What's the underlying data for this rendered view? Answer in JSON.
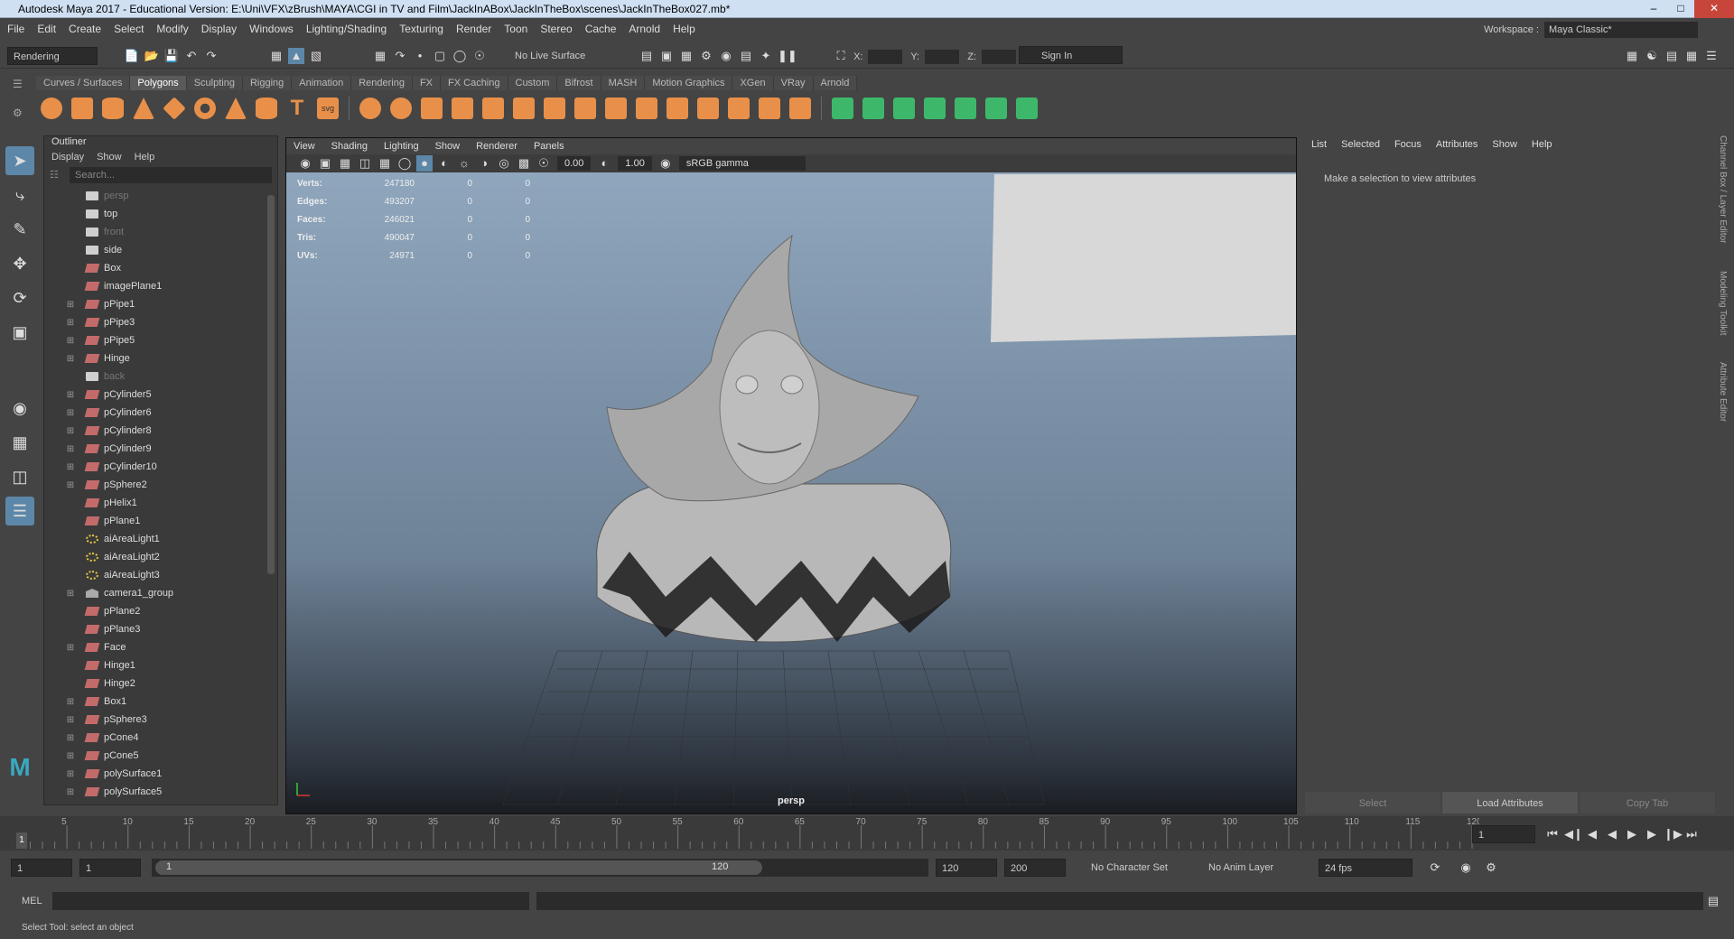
{
  "window": {
    "title": "Autodesk Maya 2017 - Educational Version: E:\\Uni\\VFX\\zBrush\\MAYA\\CGI in TV and Film\\JackInABox\\JackInTheBox\\scenes\\JackInTheBox027.mb*"
  },
  "menu": [
    "File",
    "Edit",
    "Create",
    "Select",
    "Modify",
    "Display",
    "Windows",
    "Lighting/Shading",
    "Texturing",
    "Render",
    "Toon",
    "Stereo",
    "Cache",
    "Arnold",
    "Help"
  ],
  "workspace": {
    "label": "Workspace :",
    "value": "Maya Classic*"
  },
  "status": {
    "menuset": "Rendering",
    "live_surface": "No Live Surface",
    "x_label": "X:",
    "y_label": "Y:",
    "z_label": "Z:",
    "sign_in": "Sign In"
  },
  "shelf_tabs": [
    "Curves / Surfaces",
    "Polygons",
    "Sculpting",
    "Rigging",
    "Animation",
    "Rendering",
    "FX",
    "FX Caching",
    "Custom",
    "Bifrost",
    "MASH",
    "Motion Graphics",
    "XGen",
    "VRay",
    "Arnold"
  ],
  "shelf_active": "Polygons",
  "outliner": {
    "title": "Outliner",
    "menus": [
      "Display",
      "Show",
      "Help"
    ],
    "search_placeholder": "Search...",
    "items": [
      {
        "name": "persp",
        "type": "cam",
        "dim": true,
        "exp": false
      },
      {
        "name": "top",
        "type": "cam",
        "dim": false,
        "exp": false
      },
      {
        "name": "front",
        "type": "cam",
        "dim": true,
        "exp": false
      },
      {
        "name": "side",
        "type": "cam",
        "dim": false,
        "exp": false
      },
      {
        "name": "Box",
        "type": "mesh",
        "dim": false,
        "exp": false
      },
      {
        "name": "imagePlane1",
        "type": "mesh",
        "dim": false,
        "exp": false
      },
      {
        "name": "pPipe1",
        "type": "mesh",
        "dim": false,
        "exp": true
      },
      {
        "name": "pPipe3",
        "type": "mesh",
        "dim": false,
        "exp": true
      },
      {
        "name": "pPipe5",
        "type": "mesh",
        "dim": false,
        "exp": true
      },
      {
        "name": "Hinge",
        "type": "mesh",
        "dim": false,
        "exp": true
      },
      {
        "name": "back",
        "type": "cam",
        "dim": true,
        "exp": false
      },
      {
        "name": "pCylinder5",
        "type": "mesh",
        "dim": false,
        "exp": true
      },
      {
        "name": "pCylinder6",
        "type": "mesh",
        "dim": false,
        "exp": true
      },
      {
        "name": "pCylinder8",
        "type": "mesh",
        "dim": false,
        "exp": true
      },
      {
        "name": "pCylinder9",
        "type": "mesh",
        "dim": false,
        "exp": true
      },
      {
        "name": "pCylinder10",
        "type": "mesh",
        "dim": false,
        "exp": true
      },
      {
        "name": "pSphere2",
        "type": "mesh",
        "dim": false,
        "exp": true
      },
      {
        "name": "pHelix1",
        "type": "mesh",
        "dim": false,
        "exp": false
      },
      {
        "name": "pPlane1",
        "type": "mesh",
        "dim": false,
        "exp": false
      },
      {
        "name": "aiAreaLight1",
        "type": "light",
        "dim": false,
        "exp": false
      },
      {
        "name": "aiAreaLight2",
        "type": "light",
        "dim": false,
        "exp": false
      },
      {
        "name": "aiAreaLight3",
        "type": "light",
        "dim": false,
        "exp": false
      },
      {
        "name": "camera1_group",
        "type": "grp",
        "dim": false,
        "exp": true
      },
      {
        "name": "pPlane2",
        "type": "mesh",
        "dim": false,
        "exp": false
      },
      {
        "name": "pPlane3",
        "type": "mesh",
        "dim": false,
        "exp": false
      },
      {
        "name": "Face",
        "type": "mesh",
        "dim": false,
        "exp": true
      },
      {
        "name": "Hinge1",
        "type": "mesh",
        "dim": false,
        "exp": false
      },
      {
        "name": "Hinge2",
        "type": "mesh",
        "dim": false,
        "exp": false
      },
      {
        "name": "Box1",
        "type": "mesh",
        "dim": false,
        "exp": true
      },
      {
        "name": "pSphere3",
        "type": "mesh",
        "dim": false,
        "exp": true
      },
      {
        "name": "pCone4",
        "type": "mesh",
        "dim": false,
        "exp": true
      },
      {
        "name": "pCone5",
        "type": "mesh",
        "dim": false,
        "exp": true
      },
      {
        "name": "polySurface1",
        "type": "mesh",
        "dim": false,
        "exp": true
      },
      {
        "name": "polySurface5",
        "type": "mesh",
        "dim": false,
        "exp": true
      }
    ]
  },
  "viewport": {
    "menus": [
      "View",
      "Shading",
      "Lighting",
      "Show",
      "Renderer",
      "Panels"
    ],
    "exposure": "0.00",
    "gamma": "1.00",
    "colorspace": "sRGB gamma",
    "camera": "persp",
    "hud": [
      {
        "label": "Verts:",
        "a": "247180",
        "b": "0",
        "c": "0"
      },
      {
        "label": "Edges:",
        "a": "493207",
        "b": "0",
        "c": "0"
      },
      {
        "label": "Faces:",
        "a": "246021",
        "b": "0",
        "c": "0"
      },
      {
        "label": "Tris:",
        "a": "490047",
        "b": "0",
        "c": "0"
      },
      {
        "label": "UVs:",
        "a": "24971",
        "b": "0",
        "c": "0"
      }
    ]
  },
  "attribute_editor": {
    "menus": [
      "List",
      "Selected",
      "Focus",
      "Attributes",
      "Show",
      "Help"
    ],
    "message": "Make a selection to view attributes",
    "buttons": [
      "Select",
      "Load Attributes",
      "Copy Tab"
    ]
  },
  "side_tabs": [
    "Channel Box / Layer Editor",
    "Modeling Toolkit",
    "Attribute Editor"
  ],
  "timeline": {
    "ticks": [
      "5",
      "10",
      "15",
      "20",
      "25",
      "30",
      "35",
      "40",
      "45",
      "50",
      "55",
      "60",
      "65",
      "70",
      "75",
      "80",
      "85",
      "90",
      "95",
      "100",
      "105",
      "110",
      "115",
      "120"
    ],
    "current_frame": "1",
    "current_frame_field": "1"
  },
  "range": {
    "start": "1",
    "start2": "1",
    "slider_start": "1",
    "slider_end": "120",
    "end": "120",
    "end2": "200",
    "character_set": "No Character Set",
    "anim_layer": "No Anim Layer",
    "fps": "24 fps"
  },
  "command": {
    "label": "MEL"
  },
  "statusbar": {
    "text": "Select Tool: select an object"
  }
}
